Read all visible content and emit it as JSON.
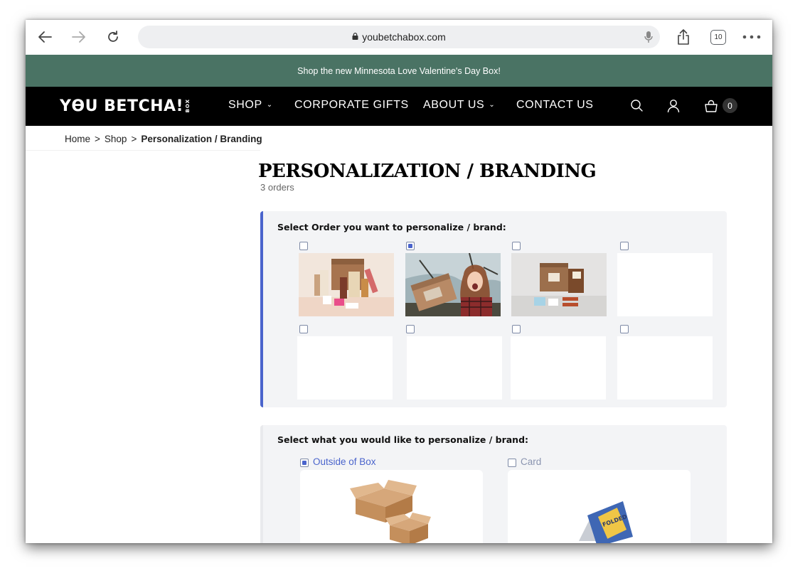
{
  "browser": {
    "url": "youbetchabox.com",
    "tab_count": "10",
    "icons": [
      "back-arrow-icon",
      "forward-arrow-icon",
      "reload-icon",
      "lock-icon",
      "mic-icon",
      "share-icon",
      "tabs-icon",
      "more-icon"
    ]
  },
  "announcement": "Shop the new Minnesota Love Valentine's Day Box!",
  "nav": {
    "logo_main": "YϴU BETCHA!",
    "logo_box": "BOX",
    "items": [
      {
        "label": "SHOP",
        "has_dropdown": true
      },
      {
        "label": "CORPORATE GIFTS",
        "has_dropdown": false
      },
      {
        "label": "ABOUT US",
        "has_dropdown": true
      },
      {
        "label": "CONTACT US",
        "has_dropdown": false
      }
    ],
    "cart_count": "0"
  },
  "breadcrumb": {
    "items": [
      "Home",
      "Shop"
    ],
    "separator": ">",
    "current": "Personalization / Branding"
  },
  "page": {
    "title": "PERSONALIZATION / BRANDING",
    "orders": "3 orders"
  },
  "order_select": {
    "label": "Select Order you want to personalize / brand:",
    "slots": [
      {
        "checked": false,
        "image": "gift-box-products"
      },
      {
        "checked": true,
        "image": "woman-holding-box"
      },
      {
        "checked": false,
        "image": "box-with-snacks"
      },
      {
        "checked": false,
        "image": ""
      },
      {
        "checked": false,
        "image": ""
      },
      {
        "checked": false,
        "image": ""
      },
      {
        "checked": false,
        "image": ""
      },
      {
        "checked": false,
        "image": ""
      }
    ]
  },
  "branding_select": {
    "label": "Select what you would like to personalize / brand:",
    "options": [
      {
        "label": "Outside of Box",
        "checked": true,
        "image": "cardboard-boxes"
      },
      {
        "label": "Card",
        "checked": false,
        "image": "folded-card"
      }
    ],
    "card_text": "FOLDED"
  },
  "colors": {
    "announcement_bg": "#4a7364",
    "nav_bg": "#000000",
    "accent": "#4a64cc",
    "panel_bg": "#f3f4f6"
  }
}
